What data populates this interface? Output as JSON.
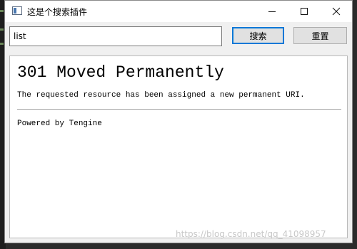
{
  "window": {
    "title": "这是个搜索插件",
    "controls": {
      "minimize": "minimize-icon",
      "maximize": "maximize-icon",
      "close": "close-icon"
    }
  },
  "toolbar": {
    "search_value": "list",
    "search_label": "搜索",
    "reset_label": "重置"
  },
  "content": {
    "heading": "301 Moved Permanently",
    "message": "The requested resource has been assigned a new permanent URI.",
    "footer": "Powered by Tengine"
  },
  "watermark": "https://blog.csdn.net/qq_41098957",
  "colors": {
    "window_bg": "#f0f0f0",
    "focus_border": "#0078d7",
    "desktop": "#2b2b2b"
  }
}
